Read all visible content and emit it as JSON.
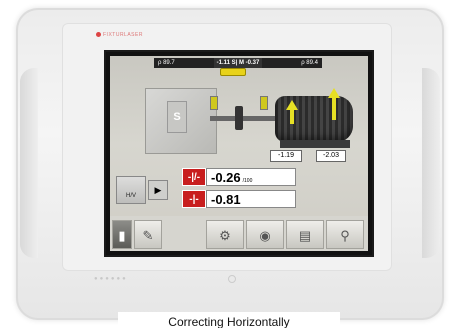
{
  "device": {
    "brand": "FIXTURLASER"
  },
  "screen": {
    "topbar": {
      "left_angle": "ρ 89.7",
      "mid": "-1.11 S| M -0.37",
      "right_angle": "ρ 89.4"
    },
    "machine_labels": {
      "stationary": "S"
    },
    "value_boxes": {
      "front_foot": "-1.19",
      "back_foot": "-2.03"
    },
    "readouts": [
      {
        "symbol": "-|/-",
        "value": "-0.26",
        "unit": "/100"
      },
      {
        "symbol": "-|-",
        "value": "-0.81",
        "unit": ""
      }
    ],
    "hv_label": "H/V"
  },
  "caption": "Correcting Horizontally"
}
